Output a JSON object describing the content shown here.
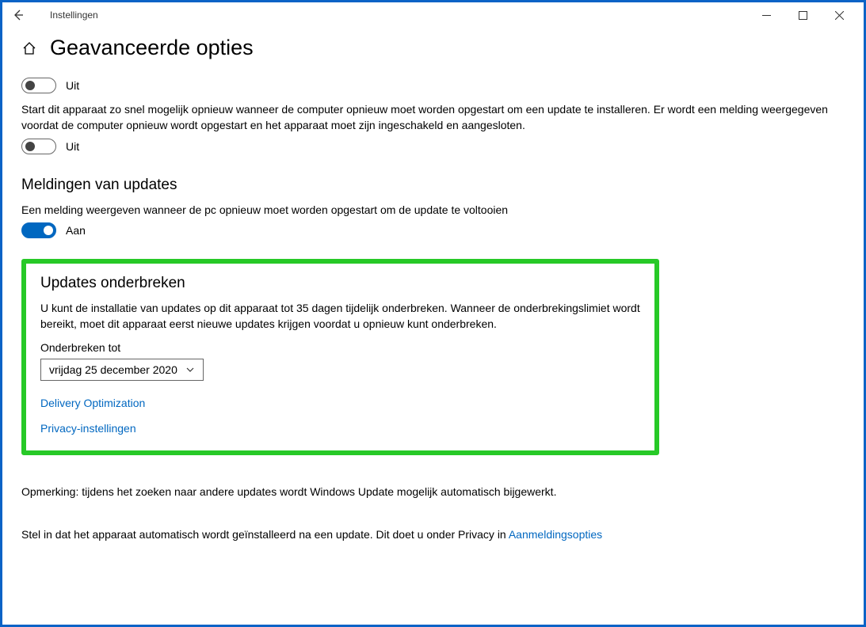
{
  "titlebar": {
    "app_title": "Instellingen"
  },
  "header": {
    "page_title": "Geavanceerde opties"
  },
  "toggle1": {
    "state_label": "Uit"
  },
  "restart_text": "Start dit apparaat zo snel mogelijk opnieuw wanneer de computer opnieuw moet worden opgestart om een update te installeren. Er wordt een melding weergegeven voordat de computer opnieuw wordt opgestart en het apparaat moet zijn ingeschakeld en aangesloten.",
  "toggle2": {
    "state_label": "Uit"
  },
  "notifications": {
    "heading": "Meldingen van updates",
    "text": "Een melding weergeven wanneer de pc opnieuw moet worden opgestart om de update te voltooien",
    "state_label": "Aan"
  },
  "pause": {
    "heading": "Updates onderbreken",
    "text": "U kunt de installatie van updates op dit apparaat tot 35 dagen tijdelijk onderbreken. Wanneer de onderbrekingslimiet wordt bereikt, moet dit apparaat eerst nieuwe updates krijgen voordat u opnieuw kunt onderbreken.",
    "field_label": "Onderbreken tot",
    "selected": "vrijdag 25 december 2020",
    "link_delivery": "Delivery Optimization",
    "link_privacy": "Privacy-instellingen"
  },
  "footer": {
    "note": "Opmerking: tijdens het zoeken naar andere updates wordt Windows Update mogelijk automatisch bijgewerkt.",
    "signin_prefix": "Stel in dat het apparaat automatisch wordt geïnstalleerd na een update. Dit doet u onder Privacy in ",
    "signin_link": "Aanmeldingsopties"
  }
}
